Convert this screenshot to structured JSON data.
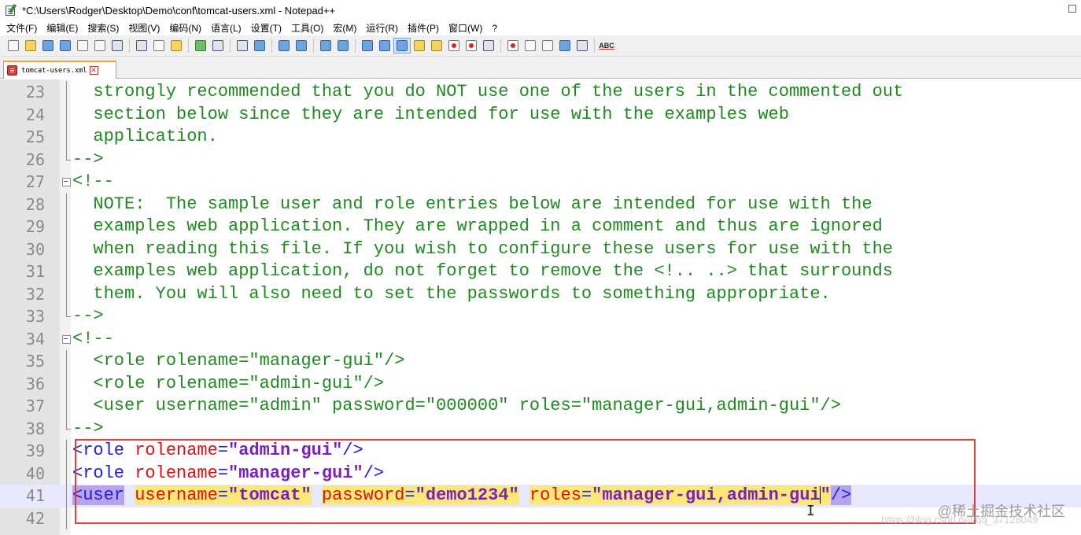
{
  "window": {
    "title": "*C:\\Users\\Rodger\\Desktop\\Demo\\conf\\tomcat-users.xml - Notepad++",
    "close_glyph": ""
  },
  "menu": [
    "文件(F)",
    "编辑(E)",
    "搜索(S)",
    "视图(V)",
    "编码(N)",
    "语言(L)",
    "设置(T)",
    "工具(O)",
    "宏(M)",
    "运行(R)",
    "插件(P)",
    "窗口(W)",
    "?"
  ],
  "toolbar": {
    "buttons": [
      "new-file",
      "open-file",
      "save",
      "save-all",
      "close",
      "close-all",
      "print",
      "cut",
      "copy",
      "paste",
      "undo",
      "redo",
      "find",
      "replace",
      "zoom-in",
      "zoom-out",
      "sync-vertical",
      "sync-horizontal",
      "word-wrap",
      "show-all-chars",
      "indent-guide",
      "user-defined-language",
      "doc-map",
      "function-list",
      "folder-as-workspace",
      "monitoring",
      "record-macro",
      "stop-recording",
      "playback-macro",
      "run-macro-multiple",
      "save-macro",
      "spell-check"
    ],
    "spellcheck_label": "ABC"
  },
  "tab": {
    "label": "tomcat-users.xml",
    "close_glyph": "✕"
  },
  "editor": {
    "lines": [
      {
        "n": "23",
        "fold": "vline",
        "segments": [
          {
            "t": "  strongly recommended that you do NOT use one of the users in the commented out",
            "c": "cmt"
          }
        ]
      },
      {
        "n": "24",
        "fold": "vline",
        "segments": [
          {
            "t": "  section below since they are intended for use with the examples web",
            "c": "cmt"
          }
        ]
      },
      {
        "n": "25",
        "fold": "vline",
        "segments": [
          {
            "t": "  application.",
            "c": "cmt"
          }
        ]
      },
      {
        "n": "26",
        "fold": "end",
        "segments": [
          {
            "t": "-->",
            "c": "cmt"
          }
        ]
      },
      {
        "n": "27",
        "fold": "box",
        "segments": [
          {
            "t": "<!--",
            "c": "cmt"
          }
        ]
      },
      {
        "n": "28",
        "fold": "vline",
        "segments": [
          {
            "t": "  NOTE:  The sample user and role entries below are intended for use with the",
            "c": "cmt"
          }
        ]
      },
      {
        "n": "29",
        "fold": "vline",
        "segments": [
          {
            "t": "  examples web application. They are wrapped in a comment and thus are ignored",
            "c": "cmt"
          }
        ]
      },
      {
        "n": "30",
        "fold": "vline",
        "segments": [
          {
            "t": "  when reading this file. If you wish to configure these users for use with the",
            "c": "cmt"
          }
        ]
      },
      {
        "n": "31",
        "fold": "vline",
        "segments": [
          {
            "t": "  examples web application, do not forget to remove the <!.. ..> that surrounds",
            "c": "cmt"
          }
        ]
      },
      {
        "n": "32",
        "fold": "vline",
        "segments": [
          {
            "t": "  them. You will also need to set the passwords to something appropriate.",
            "c": "cmt"
          }
        ]
      },
      {
        "n": "33",
        "fold": "end",
        "segments": [
          {
            "t": "-->",
            "c": "cmt"
          }
        ]
      },
      {
        "n": "34",
        "fold": "box",
        "segments": [
          {
            "t": "<!--",
            "c": "cmt"
          }
        ]
      },
      {
        "n": "35",
        "fold": "vline",
        "segments": [
          {
            "t": "  <role rolename=\"manager-gui\"/>",
            "c": "cmt"
          }
        ]
      },
      {
        "n": "36",
        "fold": "vline",
        "segments": [
          {
            "t": "  <role rolename=\"admin-gui\"/>",
            "c": "cmt"
          }
        ]
      },
      {
        "n": "37",
        "fold": "vline",
        "segments": [
          {
            "t": "  <user username=\"admin\" password=\"000000\" roles=\"manager-gui,admin-gui\"/>",
            "c": "cmt"
          }
        ]
      },
      {
        "n": "38",
        "fold": "end",
        "segments": [
          {
            "t": "-->",
            "c": "cmt"
          }
        ]
      },
      {
        "n": "39",
        "fold": "vline",
        "segments": [
          {
            "t": "<",
            "c": "tagb"
          },
          {
            "t": "role",
            "c": "tagb"
          },
          {
            "t": " ",
            "c": ""
          },
          {
            "t": "rolename",
            "c": "attr"
          },
          {
            "t": "=",
            "c": "tagb"
          },
          {
            "t": "\"admin-gui\"",
            "c": "val"
          },
          {
            "t": "/>",
            "c": "tagb"
          }
        ]
      },
      {
        "n": "40",
        "fold": "vline",
        "segments": [
          {
            "t": "<",
            "c": "tagb"
          },
          {
            "t": "role",
            "c": "tagb"
          },
          {
            "t": " ",
            "c": ""
          },
          {
            "t": "rolename",
            "c": "attr"
          },
          {
            "t": "=",
            "c": "tagb"
          },
          {
            "t": "\"manager-gui\"",
            "c": "val"
          },
          {
            "t": "/>",
            "c": "tagb"
          }
        ]
      },
      {
        "n": "41",
        "fold": "vline",
        "current": true,
        "segments": [
          {
            "t": "<user",
            "c": "tagb hl-p"
          },
          {
            "t": " ",
            "c": ""
          },
          {
            "t": "username=\"tomcat\"",
            "c": "hl-y",
            "split": true
          },
          {
            "t": " ",
            "c": ""
          },
          {
            "t": "password=\"demo1234\"",
            "c": "hl-y",
            "split": true
          },
          {
            "t": " ",
            "c": ""
          },
          {
            "t": "roles=\"manager-gui,admin-gui",
            "c": "hl-y",
            "split": true
          },
          {
            "t": "CARET",
            "c": "caret"
          },
          {
            "t": "\"",
            "c": "val hl-y"
          },
          {
            "t": "/>",
            "c": "tagb hl-p"
          }
        ]
      },
      {
        "n": "42",
        "fold": "vline",
        "segments": []
      }
    ]
  },
  "colors": {
    "comment": "#1f8a1f",
    "tag": "#2020d8",
    "attribute": "#e01010",
    "value": "#7b1fc4",
    "highlight_yellow": "#fce877",
    "highlight_purple": "#b7a3f0",
    "annotation_box": "#e53c3c",
    "current_line": "#e8e8ff"
  },
  "watermark": {
    "text": "@稀土掘金技术社区",
    "url_fragment": "https://blog.csdn.net/qq_37128049"
  }
}
